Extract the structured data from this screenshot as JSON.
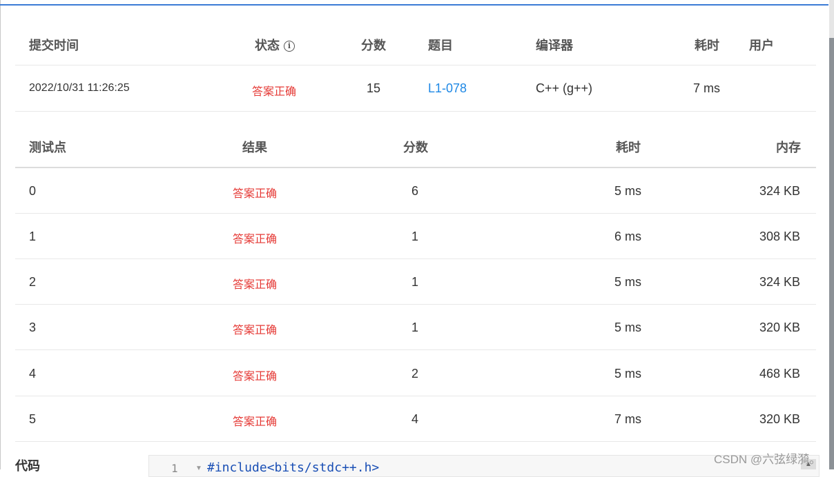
{
  "submission": {
    "headers": {
      "time": "提交时间",
      "status": "状态",
      "score": "分数",
      "problem": "题目",
      "compiler": "编译器",
      "elapsed": "耗时",
      "user": "用户"
    },
    "row": {
      "time": "2022/10/31 11:26:25",
      "status": "答案正确",
      "score": "15",
      "problem": "L1-078",
      "compiler": "C++ (g++)",
      "elapsed": "7 ms",
      "user": ""
    }
  },
  "tests": {
    "headers": {
      "case": "测试点",
      "result": "结果",
      "score": "分数",
      "elapsed": "耗时",
      "memory": "内存"
    },
    "rows": [
      {
        "case": "0",
        "result": "答案正确",
        "score": "6",
        "elapsed": "5 ms",
        "memory": "324 KB"
      },
      {
        "case": "1",
        "result": "答案正确",
        "score": "1",
        "elapsed": "6 ms",
        "memory": "308 KB"
      },
      {
        "case": "2",
        "result": "答案正确",
        "score": "1",
        "elapsed": "5 ms",
        "memory": "324 KB"
      },
      {
        "case": "3",
        "result": "答案正确",
        "score": "1",
        "elapsed": "5 ms",
        "memory": "320 KB"
      },
      {
        "case": "4",
        "result": "答案正确",
        "score": "2",
        "elapsed": "5 ms",
        "memory": "468 KB"
      },
      {
        "case": "5",
        "result": "答案正确",
        "score": "4",
        "elapsed": "7 ms",
        "memory": "320 KB"
      }
    ]
  },
  "code": {
    "label": "代码",
    "first_line_number": "1",
    "first_line": "#include<bits/stdc++.h>"
  },
  "watermark": "CSDN @六弦绿漪。",
  "icons": {
    "status_info": "info-icon",
    "fold": "fold-arrow-icon",
    "scroll": "scroll-up-icon"
  },
  "colors": {
    "accepted": "#e53935",
    "link": "#1e88e5"
  }
}
